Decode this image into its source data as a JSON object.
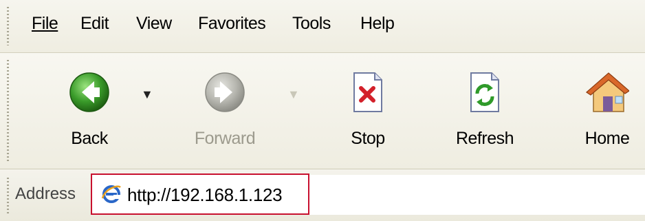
{
  "menubar": {
    "items": [
      {
        "label": "File"
      },
      {
        "label": "Edit"
      },
      {
        "label": "View"
      },
      {
        "label": "Favorites"
      },
      {
        "label": "Tools"
      },
      {
        "label": "Help"
      }
    ]
  },
  "toolbar": {
    "back_label": "Back",
    "forward_label": "Forward",
    "stop_label": "Stop",
    "refresh_label": "Refresh",
    "home_label": "Home",
    "dropdown_glyph": "▼"
  },
  "addressbar": {
    "label": "Address",
    "url": "http://192.168.1.123",
    "highlight_color": "#c8102e"
  },
  "colors": {
    "back_green": "#3a9b2a",
    "forward_disabled_gray": "#b7b7b0"
  }
}
